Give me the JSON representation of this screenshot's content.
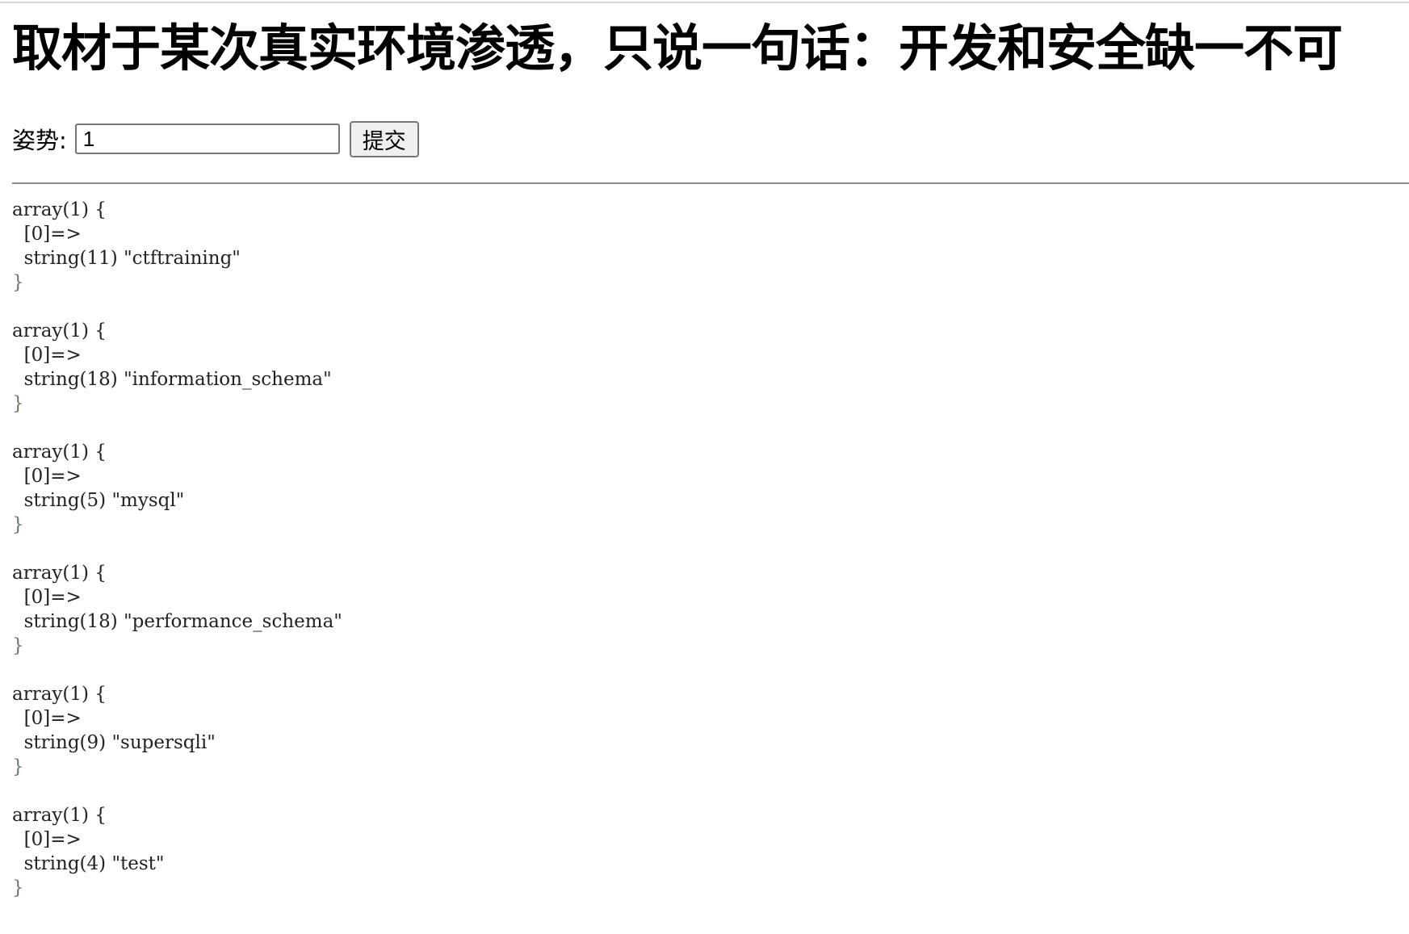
{
  "page": {
    "title": "取材于某次真实环境渗透，只说一句话：开发和安全缺一不可"
  },
  "form": {
    "label": "姿势:",
    "input_value": "1",
    "submit_label": "提交"
  },
  "output": [
    {
      "header": "array(1) {",
      "key": "  [0]=>",
      "value": "  string(11) \"ctftraining\"",
      "close": "}"
    },
    {
      "header": "array(1) {",
      "key": "  [0]=>",
      "value": "  string(18) \"information_schema\"",
      "close": "}"
    },
    {
      "header": "array(1) {",
      "key": "  [0]=>",
      "value": "  string(5) \"mysql\"",
      "close": "}"
    },
    {
      "header": "array(1) {",
      "key": "  [0]=>",
      "value": "  string(18) \"performance_schema\"",
      "close": "}"
    },
    {
      "header": "array(1) {",
      "key": "  [0]=>",
      "value": "  string(9) \"supersqli\"",
      "close": "}"
    },
    {
      "header": "array(1) {",
      "key": "  [0]=>",
      "value": "  string(4) \"test\"",
      "close": "}"
    }
  ]
}
